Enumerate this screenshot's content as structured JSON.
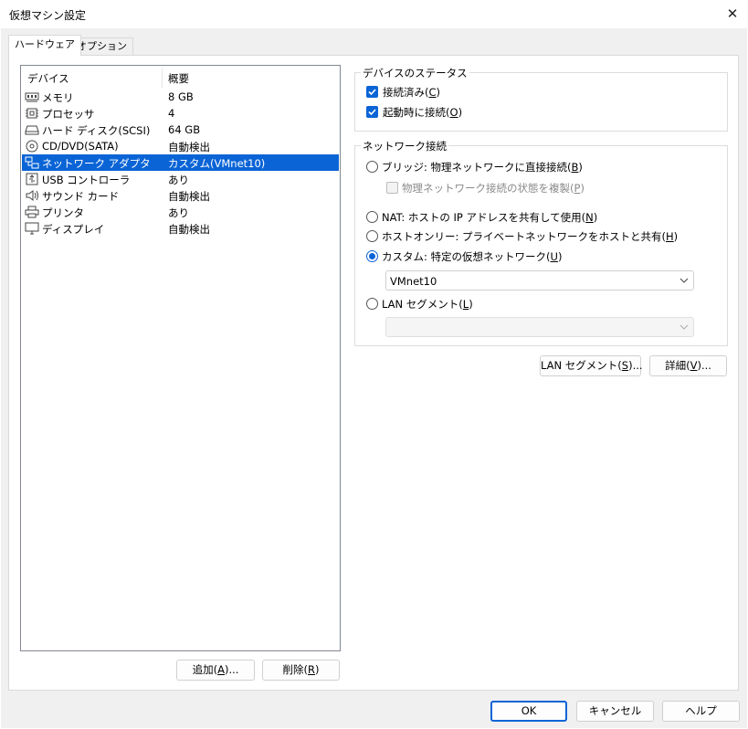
{
  "window": {
    "title": "仮想マシン設定",
    "close_glyph": "✕"
  },
  "tabs": [
    {
      "label": "ハードウェア",
      "active": true
    },
    {
      "label": "オプション",
      "active": false
    }
  ],
  "device_list": {
    "columns": [
      "デバイス",
      "概要"
    ],
    "rows": [
      {
        "icon": "memory-icon",
        "name": "メモリ",
        "summary": "8 GB",
        "selected": false
      },
      {
        "icon": "processor-icon",
        "name": "プロセッサ",
        "summary": "4",
        "selected": false
      },
      {
        "icon": "hard-disk-icon",
        "name": "ハード ディスク(SCSI)",
        "summary": "64 GB",
        "selected": false
      },
      {
        "icon": "cd-dvd-icon",
        "name": "CD/DVD(SATA)",
        "summary": "自動検出",
        "selected": false
      },
      {
        "icon": "network-adapter-icon",
        "name": "ネットワーク アダプタ",
        "summary": "カスタム(VMnet10)",
        "selected": true
      },
      {
        "icon": "usb-icon",
        "name": "USB コントローラ",
        "summary": "あり",
        "selected": false
      },
      {
        "icon": "sound-card-icon",
        "name": "サウンド カード",
        "summary": "自動検出",
        "selected": false
      },
      {
        "icon": "printer-icon",
        "name": "プリンタ",
        "summary": "あり",
        "selected": false
      },
      {
        "icon": "display-icon",
        "name": "ディスプレイ",
        "summary": "自動検出",
        "selected": false
      }
    ],
    "add_button": {
      "text": "追加(",
      "mnemonic": "A",
      "suffix": ")..."
    },
    "remove_button": {
      "text": "削除(",
      "mnemonic": "R",
      "suffix": ")"
    }
  },
  "device_status": {
    "title": "デバイスのステータス",
    "connected": {
      "text": "接続済み(",
      "mnemonic": "C",
      "suffix": ")",
      "checked": true
    },
    "connect_on_power_on": {
      "text": "起動時に接続(",
      "mnemonic": "O",
      "suffix": ")",
      "checked": true
    }
  },
  "network_connection": {
    "title": "ネットワーク接続",
    "bridged": {
      "text": "ブリッジ: 物理ネットワークに直接接続(",
      "mnemonic": "B",
      "suffix": ")",
      "selected": false
    },
    "replicate": {
      "text": "物理ネットワーク接続の状態を複製(",
      "mnemonic": "P",
      "suffix": ")",
      "checked": false,
      "enabled": false
    },
    "nat": {
      "text": "NAT: ホストの IP アドレスを共有して使用(",
      "mnemonic": "N",
      "suffix": ")",
      "selected": false
    },
    "host_only": {
      "text": "ホストオンリー: プライベートネットワークをホストと共有(",
      "mnemonic": "H",
      "suffix": ")",
      "selected": false
    },
    "custom": {
      "text": "カスタム: 特定の仮想ネットワーク(",
      "mnemonic": "U",
      "suffix": ")",
      "selected": true
    },
    "custom_select": {
      "value": "VMnet10"
    },
    "lan_segment": {
      "text": "LAN セグメント(",
      "mnemonic": "L",
      "suffix": ")",
      "selected": false
    },
    "lan_segment_select": {
      "value": "",
      "enabled": false
    }
  },
  "buttons": {
    "lan_segment": {
      "text": "LAN セグメント(",
      "mnemonic": "S",
      "suffix": ")..."
    },
    "advanced": {
      "text": "詳細(",
      "mnemonic": "V",
      "suffix": ")..."
    },
    "ok": "OK",
    "cancel": "キャンセル",
    "help": "ヘルプ"
  },
  "colors": {
    "accent": "#0a64d6",
    "dialog_bg": "#f0f0f0",
    "panel_bg": "#ffffff"
  }
}
